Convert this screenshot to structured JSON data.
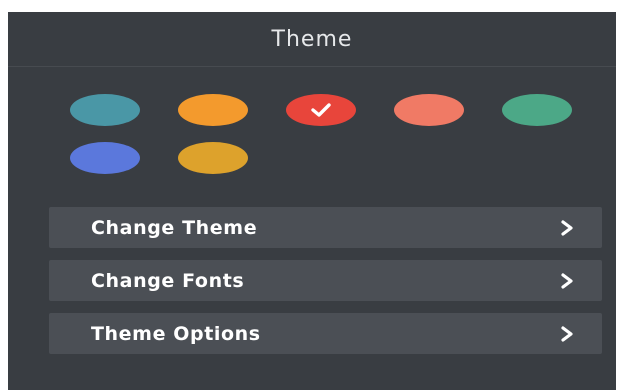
{
  "panel": {
    "title": "Theme"
  },
  "swatches": [
    {
      "color": "#4a97a6",
      "selected": false
    },
    {
      "color": "#f39a2d",
      "selected": false
    },
    {
      "color": "#e8453b",
      "selected": true
    },
    {
      "color": "#f07a65",
      "selected": false
    },
    {
      "color": "#4ca887",
      "selected": false
    },
    {
      "color": "#5b78dc",
      "selected": false
    },
    {
      "color": "#dda22c",
      "selected": false
    }
  ],
  "menu": {
    "items": [
      {
        "label": "Change Theme",
        "icon": "chevron-right-icon"
      },
      {
        "label": "Change Fonts",
        "icon": "chevron-right-icon"
      },
      {
        "label": "Theme Options",
        "icon": "chevron-right-icon"
      }
    ]
  },
  "colors": {
    "panel_bg": "#393d42",
    "menu_item_bg": "#4b4f55",
    "text": "#ffffff",
    "check": "#ffffff"
  }
}
